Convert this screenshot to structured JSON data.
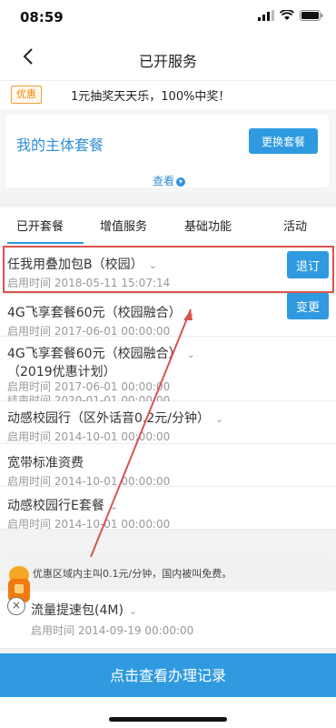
{
  "status": {
    "time": "08:59"
  },
  "nav": {
    "title": "已开服务"
  },
  "promo": {
    "badge": "优惠",
    "text": "1元抽奖天天乐，100%中奖！"
  },
  "plan": {
    "title": "我的主体套餐",
    "change_button": "更换套餐",
    "view_link": "查看"
  },
  "tabs": [
    {
      "label": "已开套餐"
    },
    {
      "label": "增值服务"
    },
    {
      "label": "基础功能"
    },
    {
      "label": "活动"
    }
  ],
  "items": [
    {
      "name": "任我用叠加包B（校园）",
      "lines": [
        "启用时间 2018-05-11 15:07:14"
      ],
      "action": "退订"
    },
    {
      "name": "4G飞享套餐60元（校园融合）",
      "lines": [
        "启用时间 2017-06-01 00:00:00"
      ],
      "action": "变更"
    },
    {
      "name": "4G飞享套餐60元（校园融合）",
      "name2": "（2019优惠计划）",
      "lines": [
        "启用时间 2017-06-01 00:00:00",
        "结束时间 2020-01-01 00:00:00"
      ]
    },
    {
      "name": "动感校园行（区外话音0.2元/分钟）",
      "lines": [
        "启用时间 2014-10-01 00:00:00"
      ]
    },
    {
      "name": "宽带标准资费",
      "lines": [
        "启用时间 2014-10-01 00:00:00"
      ]
    },
    {
      "name": "动感校园行E套餐",
      "lines": [
        "启用时间 2014-10-01 00:00:00"
      ]
    }
  ],
  "notice": {
    "text": "优惠区域内主叫0.1元/分钟，国内被叫免费。"
  },
  "last_item": {
    "name": "流量提速包(4M)",
    "line": "启用时间 2014-09-19 00:00:00"
  },
  "bottom_button": {
    "label": "点击查看办理记录"
  },
  "colors": {
    "accent": "#2f9ae0",
    "highlight": "#d9534f",
    "promo": "#f08a00"
  }
}
